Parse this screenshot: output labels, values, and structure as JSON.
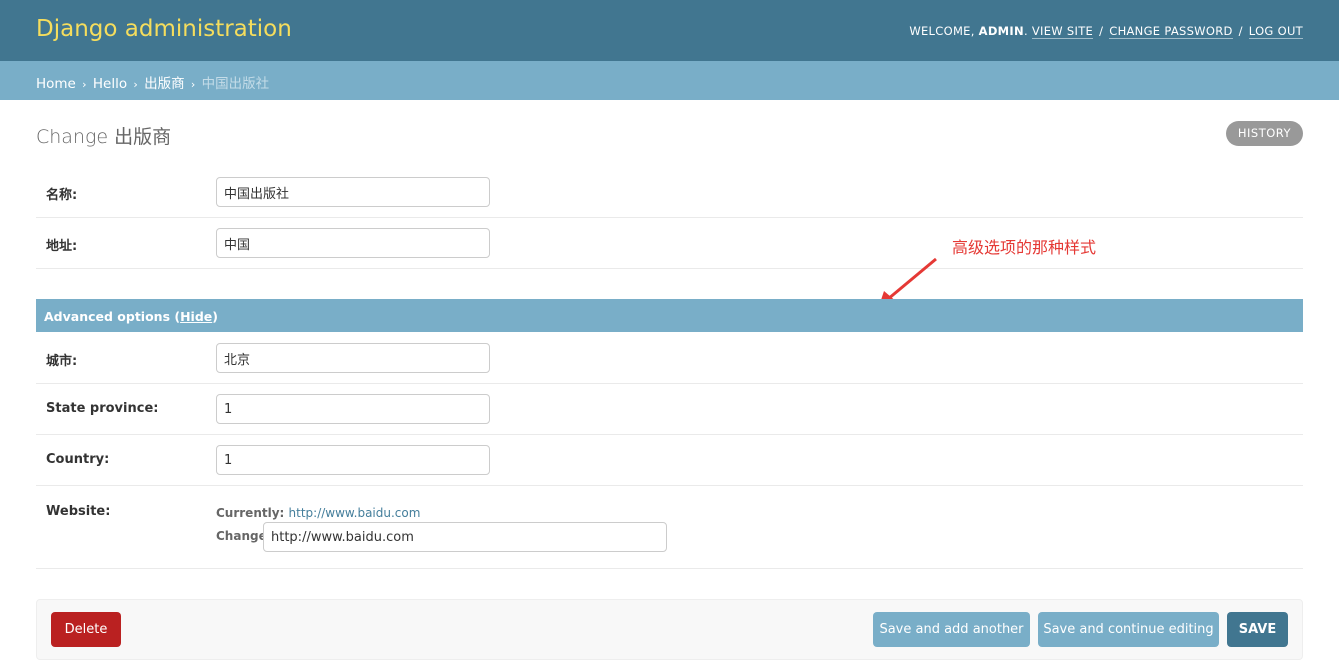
{
  "header": {
    "branding": "Django administration",
    "welcome_prefix": "WELCOME, ",
    "username": "ADMIN",
    "welcome_suffix": ".",
    "view_site": "VIEW SITE",
    "sep1": "/",
    "change_password": "CHANGE PASSWORD",
    "sep2": "/",
    "log_out": "LOG OUT"
  },
  "breadcrumbs": {
    "home": "Home",
    "app": "Hello",
    "model": "出版商",
    "current": "中国出版社",
    "separator": "›"
  },
  "page": {
    "title": "Change 出版商",
    "history_button": "HISTORY"
  },
  "fields": {
    "name": {
      "label": "名称:",
      "value": "中国出版社"
    },
    "address": {
      "label": "地址:",
      "value": "中国"
    }
  },
  "advanced": {
    "title_prefix": "Advanced options (",
    "hide_link": "Hide",
    "title_suffix": ")",
    "city": {
      "label": "城市:",
      "value": "北京"
    },
    "state_province": {
      "label": "State province:",
      "value": "1"
    },
    "country": {
      "label": "Country:",
      "value": "1"
    },
    "website": {
      "label": "Website:",
      "currently_label": "Currently:",
      "currently_value": "http://www.baidu.com",
      "change_label": "Change:",
      "value": "http://www.baidu.com"
    }
  },
  "annotation": {
    "text": "高级选项的那种样式",
    "color": "#e53935"
  },
  "actions": {
    "delete": "Delete",
    "save_add_another": "Save and add another",
    "save_continue": "Save and continue editing",
    "save": "SAVE"
  },
  "colors": {
    "header_bg": "#417690",
    "branding": "#f5dd5d",
    "breadcrumb_bg": "#79aec8",
    "delete_bg": "#ba2121",
    "save_bg": "#417690",
    "secondary_button_bg": "#79aec8"
  },
  "icons": {
    "arrow": "red-arrow-icon"
  }
}
